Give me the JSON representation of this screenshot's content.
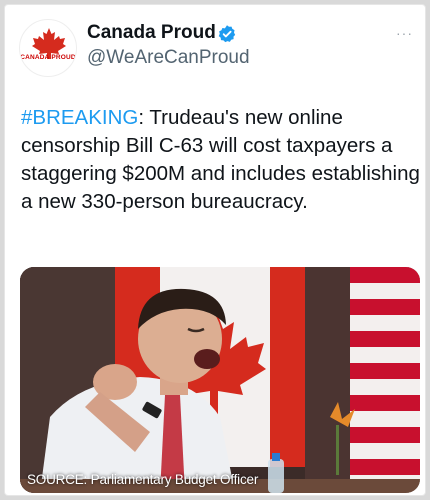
{
  "account": {
    "display_name": "Canada Proud",
    "handle": "@WeAreCanProud",
    "avatar_text": "CANADA PROUD",
    "verified_icon": "verified-badge-icon",
    "more_icon": "more-options-icon"
  },
  "tweet": {
    "hashtag": "#BREAKING",
    "text": ": Trudeau's new online censorship Bill C-63 will cost taxpayers a staggering $200M and includes establishing a new 330-person bureaucracy."
  },
  "media": {
    "caption": "SOURCE: Parliamentary Budget Officer"
  },
  "colors": {
    "accent": "#1d9bf0",
    "text": "#0f1419",
    "secondary": "#536471",
    "flag_red": "#d52b1e"
  }
}
